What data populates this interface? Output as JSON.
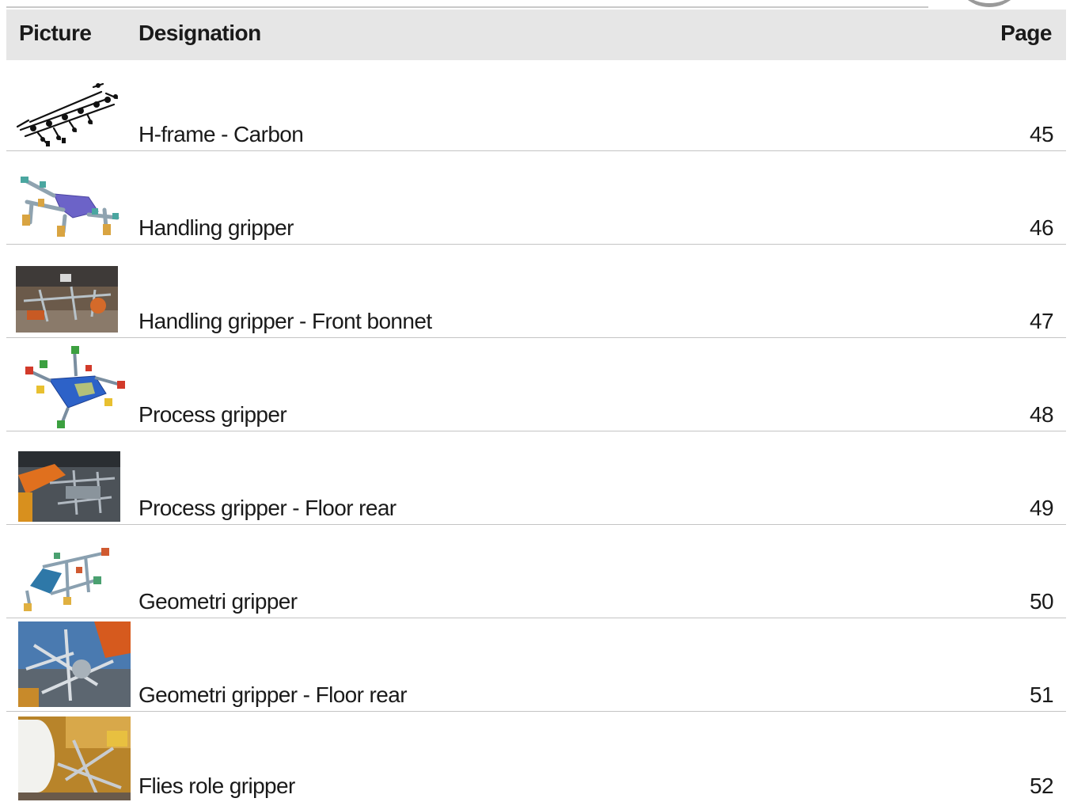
{
  "header": {
    "picture": "Picture",
    "designation": "Designation",
    "page": "Page"
  },
  "rows": [
    {
      "designation": "H-frame - Carbon",
      "page": "45",
      "picture": "h-frame-carbon-drawing"
    },
    {
      "designation": "Handling gripper",
      "page": "46",
      "picture": "handling-gripper-render"
    },
    {
      "designation": "Handling gripper - Front bonnet",
      "page": "47",
      "picture": "front-bonnet-photo"
    },
    {
      "designation": "Process gripper",
      "page": "48",
      "picture": "process-gripper-render"
    },
    {
      "designation": "Process gripper - Floor rear",
      "page": "49",
      "picture": "floor-rear-photo"
    },
    {
      "designation": "Geometri gripper",
      "page": "50",
      "picture": "geometri-gripper-render"
    },
    {
      "designation": "Geometri gripper - Floor rear",
      "page": "51",
      "picture": "geometri-floor-rear-photo"
    },
    {
      "designation": "Flies role gripper",
      "page": "52",
      "picture": "flies-role-photo"
    }
  ]
}
